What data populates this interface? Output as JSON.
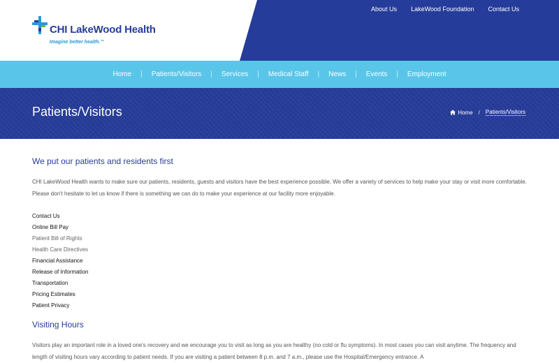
{
  "header": {
    "logo_name": "CHI LakeWood Health",
    "logo_tagline": "Imagine better health.℠",
    "top_links": [
      "About Us",
      "LakeWood Foundation",
      "Contact Us"
    ],
    "colors": {
      "brand_blue": "#263c9a",
      "nav_cyan": "#59c6e9",
      "tagline_blue": "#2a9ad4"
    }
  },
  "nav": {
    "items": [
      "Home",
      "Patients/Visitors",
      "Services",
      "Medical Staff",
      "News",
      "Events",
      "Employment"
    ]
  },
  "banner": {
    "title": "Patients/Visitors",
    "breadcrumb": {
      "home_icon": "home-icon",
      "home": "Home",
      "separator": "/",
      "current": "Patients/Visitors"
    }
  },
  "main": {
    "heading": "We put our patients and residents first",
    "intro": "CHI LakeWood Health wants to make sure our patients, residents, guests and visitors have the best experience possible. We offer a variety of services to help make your stay or visit more comfortable. Please don't hesitate to let us know if there is something we can do to make your experience at our facility more enjoyable.",
    "links": [
      {
        "label": "Contact Us",
        "muted": false
      },
      {
        "label": "Online Bill Pay",
        "muted": false
      },
      {
        "label": "Patient Bill of Rights",
        "muted": true
      },
      {
        "label": "Health Care Directives",
        "muted": true
      },
      {
        "label": "Financial Assistance",
        "muted": false
      },
      {
        "label": "Release of Information",
        "muted": false
      },
      {
        "label": "Transportation",
        "muted": false
      },
      {
        "label": "Pricing Estimates",
        "muted": false
      },
      {
        "label": "Patient Privacy",
        "muted": false
      }
    ],
    "visiting_heading": "Visiting Hours",
    "visiting_text": "Visitors play an important role in a loved one's recovery and we encourage you to visit as long as you are healthy (no cold or flu symptoms).  In most cases you can visit anytime. The frequency and length of visiting hours vary according to patient needs. If you are visiting a patient between 8 p.m. and 7 a.m., please use the Hospital/Emergency entrance. A"
  }
}
